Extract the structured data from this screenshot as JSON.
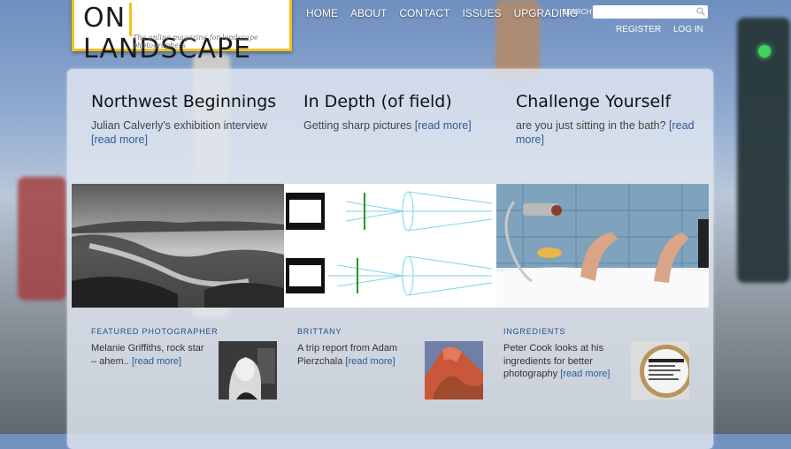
{
  "header": {
    "logo_word": "ON LANDSCAPE",
    "logo_tagline": "The online magazine for landscape photographers",
    "nav": [
      "HOME",
      "ABOUT",
      "CONTACT",
      "ISSUES",
      "UPGRADING"
    ],
    "search_label": "SEARCH",
    "search_placeholder": "",
    "register": "REGISTER",
    "login": "LOG IN"
  },
  "features": [
    {
      "title": "Northwest Beginnings",
      "text": "Julian Calverly's exhibition interview ",
      "link": "[read more]"
    },
    {
      "title": "In Depth (of field)",
      "text": "Getting sharp pictures ",
      "link": "[read more]"
    },
    {
      "title": "Challenge Yourself",
      "text": "are you just sitting in the bath? ",
      "link": "[read more]"
    }
  ],
  "items": [
    {
      "category": "FEATURED PHOTOGRAPHER",
      "text": "Melanie Griffiths, rock star – ahem.. ",
      "link": "[read more]"
    },
    {
      "category": "BRITTANY",
      "text": "A trip report from Adam Pierzchala ",
      "link": "[read more]"
    },
    {
      "category": "INGREDIENTS",
      "text": "Peter Cook looks at his ingredients for better photography ",
      "link": "[read more]"
    }
  ],
  "colors": {
    "accent": "#f3c11a",
    "link": "#2e5b96",
    "category": "#1f4f8c"
  },
  "icons": {
    "search": "search-icon"
  }
}
